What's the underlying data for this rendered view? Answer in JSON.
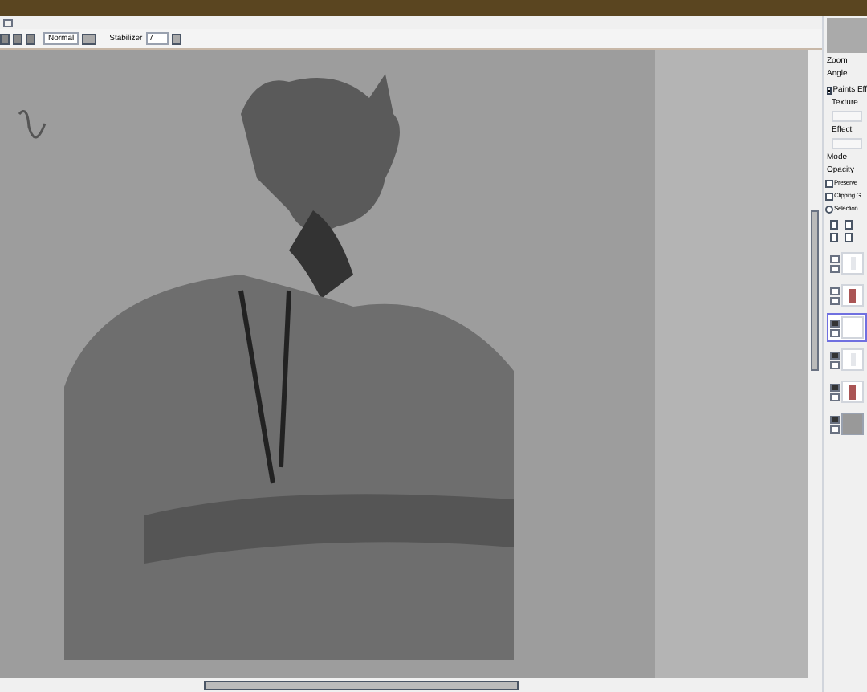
{
  "toolbar": {
    "blend_mode": "Normal",
    "stabilizer_label": "Stabilizer",
    "stabilizer_value": "7"
  },
  "side_panel": {
    "zoom_label": "Zoom",
    "angle_label": "Angle",
    "paints_effect": {
      "label": "Paints Eff",
      "expanded": true
    },
    "texture_label": "Texture",
    "effect_label": "Effect",
    "mode_label": "Mode",
    "opacity_label": "Opacity",
    "options": [
      {
        "kind": "checkbox",
        "label": "Preserve",
        "checked": false
      },
      {
        "kind": "checkbox",
        "label": "Clipping G",
        "checked": false
      },
      {
        "kind": "radio",
        "label": "Selection",
        "checked": false
      }
    ],
    "layers": [
      {
        "visible": false,
        "selected": false,
        "kind": "sketch"
      },
      {
        "visible": false,
        "selected": false,
        "kind": "figure"
      },
      {
        "visible": true,
        "selected": true,
        "kind": "blank"
      },
      {
        "visible": true,
        "selected": false,
        "kind": "sketch"
      },
      {
        "visible": true,
        "selected": false,
        "kind": "figure"
      },
      {
        "visible": true,
        "selected": false,
        "kind": "fill"
      }
    ]
  }
}
